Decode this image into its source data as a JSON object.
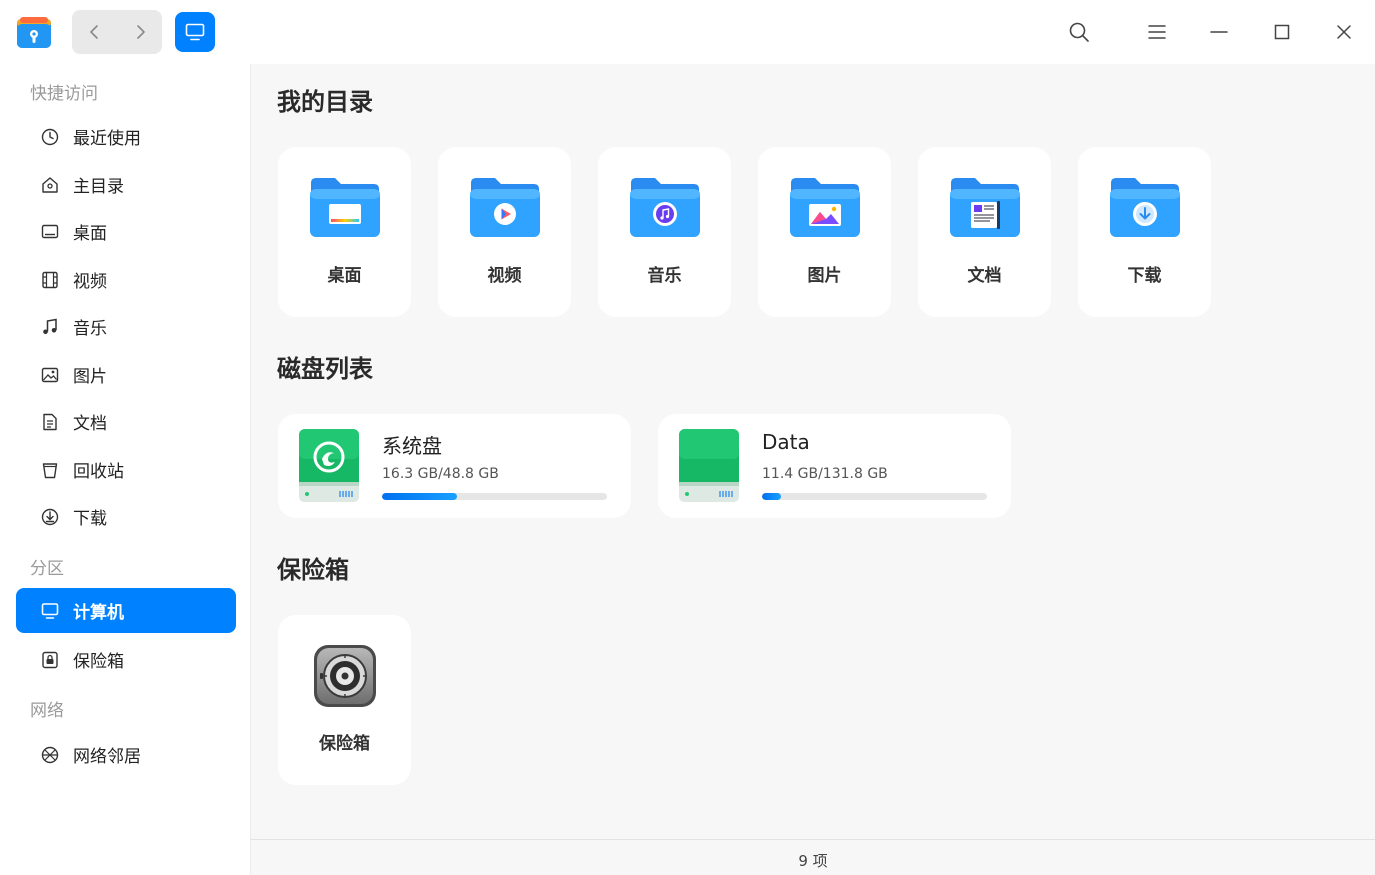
{
  "titlebar": {
    "logo_icon": "file-manager-logo",
    "back_icon": "chevron-left-icon",
    "forward_icon": "chevron-right-icon",
    "view_icon": "monitor-icon",
    "accent": "#0081ff"
  },
  "sidebar": {
    "quick_access_label": "快捷访问",
    "quick_items": [
      {
        "label": "最近使用",
        "icon": "clock-icon"
      },
      {
        "label": "主目录",
        "icon": "home-icon"
      },
      {
        "label": "桌面",
        "icon": "desktop-icon"
      },
      {
        "label": "视频",
        "icon": "film-icon"
      },
      {
        "label": "音乐",
        "icon": "music-note-icon"
      },
      {
        "label": "图片",
        "icon": "image-icon"
      },
      {
        "label": "文档",
        "icon": "document-icon"
      },
      {
        "label": "回收站",
        "icon": "trash-icon"
      },
      {
        "label": "下载",
        "icon": "download-icon"
      }
    ],
    "partition_label": "分区",
    "partition_items": [
      {
        "label": "计算机",
        "icon": "computer-icon",
        "active": true
      },
      {
        "label": "保险箱",
        "icon": "vault-icon"
      }
    ],
    "network_label": "网络",
    "network_items": [
      {
        "label": "网络邻居",
        "icon": "network-icon"
      }
    ]
  },
  "main": {
    "dirs_title": "我的目录",
    "dirs": [
      {
        "label": "桌面",
        "icon": "desktop-folder-icon"
      },
      {
        "label": "视频",
        "icon": "video-folder-icon"
      },
      {
        "label": "音乐",
        "icon": "music-folder-icon"
      },
      {
        "label": "图片",
        "icon": "pictures-folder-icon"
      },
      {
        "label": "文档",
        "icon": "documents-folder-icon"
      },
      {
        "label": "下载",
        "icon": "downloads-folder-icon"
      }
    ],
    "disks_title": "磁盘列表",
    "disks": [
      {
        "name": "系统盘",
        "size": "16.3 GB/48.8 GB",
        "usage": 0.334,
        "icon": "system-disk-icon"
      },
      {
        "name": "Data",
        "size": "11.4 GB/131.8 GB",
        "usage": 0.086,
        "icon": "data-disk-icon"
      }
    ],
    "vault_title": "保险箱",
    "vault": {
      "label": "保险箱",
      "icon": "safe-icon"
    }
  },
  "status": {
    "count": "9 项"
  }
}
